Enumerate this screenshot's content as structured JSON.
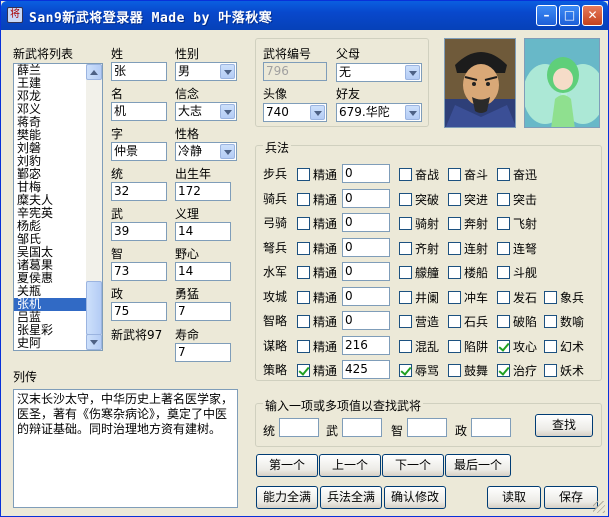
{
  "window": {
    "title": "San9新武将登录器 Made by 叶落秋寒",
    "minimize_glyph": "–",
    "maximize_glyph": "□",
    "close_glyph": "✕",
    "app_icon_glyph": "将"
  },
  "general_list": {
    "label": "新武将列表",
    "items": [
      "薛兰",
      "王建",
      "邓龙",
      "邓义",
      "蒋奇",
      "樊能",
      "刘磐",
      "刘豹",
      "鄞宓",
      "甘梅",
      "糜夫人",
      "辛宪英",
      "杨彪",
      "邹氏",
      "吴国太",
      "诸葛果",
      "夏侯惠",
      "关瓶",
      "张机",
      "吕蓝",
      "张星彩",
      "史阿"
    ],
    "selected_index": 18
  },
  "profile": {
    "surname_label": "姓",
    "surname": "张",
    "given_label": "名",
    "given": "机",
    "style_label": "字",
    "style_name": "仲景",
    "gender_label": "性别",
    "gender": "男",
    "belief_label": "信念",
    "belief": "大志",
    "personality_label": "性格",
    "personality": "冷静",
    "lead_label": "统",
    "lead": "32",
    "birth_label": "出生年",
    "birth": "172",
    "war_label": "武",
    "war": "39",
    "justice_label": "义理",
    "justice": "14",
    "int_label": "智",
    "int": "73",
    "ambition_label": "野心",
    "ambition": "14",
    "pol_label": "政",
    "pol": "75",
    "brave_label": "勇猛",
    "brave": "7",
    "new_general_text": "新武将97",
    "lifespan_label": "寿命",
    "lifespan": "7"
  },
  "info": {
    "id_label": "武将编号",
    "id": "796",
    "parent_label": "父母",
    "parent": "无",
    "face_label": "头像",
    "face": "740",
    "friend_label": "好友",
    "friend": "679.华陀"
  },
  "biography": {
    "label": "列传",
    "text": "汉末长沙太守，中华历史上著名医学家，医圣，著有《伤寒杂病论》，奠定了中医的辩证基础。同时治理地方资有建树。"
  },
  "tactics": {
    "title": "兵法",
    "expert_label": "精通",
    "rows": [
      {
        "label": "步兵",
        "expert": false,
        "value": "0",
        "skills": [
          {
            "name": "奋战",
            "on": false
          },
          {
            "name": "奋斗",
            "on": false
          },
          {
            "name": "奋迅",
            "on": false
          }
        ]
      },
      {
        "label": "骑兵",
        "expert": false,
        "value": "0",
        "skills": [
          {
            "name": "突破",
            "on": false
          },
          {
            "name": "突进",
            "on": false
          },
          {
            "name": "突击",
            "on": false
          }
        ]
      },
      {
        "label": "弓骑",
        "expert": false,
        "value": "0",
        "skills": [
          {
            "name": "骑射",
            "on": false
          },
          {
            "name": "奔射",
            "on": false
          },
          {
            "name": "飞射",
            "on": false
          }
        ]
      },
      {
        "label": "弩兵",
        "expert": false,
        "value": "0",
        "skills": [
          {
            "name": "齐射",
            "on": false
          },
          {
            "name": "连射",
            "on": false
          },
          {
            "name": "连弩",
            "on": false
          }
        ]
      },
      {
        "label": "水军",
        "expert": false,
        "value": "0",
        "skills": [
          {
            "name": "艨艟",
            "on": false
          },
          {
            "name": "楼船",
            "on": false
          },
          {
            "name": "斗舰",
            "on": false
          }
        ]
      },
      {
        "label": "攻城",
        "expert": false,
        "value": "0",
        "skills": [
          {
            "name": "井阑",
            "on": false
          },
          {
            "name": "冲车",
            "on": false
          },
          {
            "name": "发石",
            "on": false
          },
          {
            "name": "象兵",
            "on": false
          }
        ]
      },
      {
        "label": "智略",
        "expert": false,
        "value": "0",
        "skills": [
          {
            "name": "营造",
            "on": false
          },
          {
            "name": "石兵",
            "on": false
          },
          {
            "name": "破陷",
            "on": false
          },
          {
            "name": "数喻",
            "on": false
          }
        ]
      },
      {
        "label": "谋略",
        "expert": false,
        "value": "216",
        "skills": [
          {
            "name": "混乱",
            "on": false
          },
          {
            "name": "陷阱",
            "on": false
          },
          {
            "name": "攻心",
            "on": true
          },
          {
            "name": "幻术",
            "on": false
          }
        ]
      },
      {
        "label": "策略",
        "expert": true,
        "value": "425",
        "skills": [
          {
            "name": "辱骂",
            "on": true
          },
          {
            "name": "鼓舞",
            "on": false
          },
          {
            "name": "治疗",
            "on": true
          },
          {
            "name": "妖术",
            "on": false
          }
        ]
      }
    ]
  },
  "search": {
    "title": "输入一项或多项值以查找武将",
    "lead_label": "统",
    "war_label": "武",
    "int_label": "智",
    "pol_label": "政",
    "lead": "",
    "war": "",
    "int": "",
    "pol": "",
    "button": "查找"
  },
  "nav": {
    "first": "第一个",
    "prev": "上一个",
    "next": "下一个",
    "last": "最后一个"
  },
  "actions": {
    "max_ability": "能力全满",
    "max_tactics": "兵法全满",
    "confirm": "确认修改",
    "read": "读取",
    "save": "保存"
  },
  "colors": {
    "title_bar": "#0848cc",
    "selection": "#316ac5",
    "window_bg": "#ece9d8",
    "check_mark": "#21a121"
  }
}
